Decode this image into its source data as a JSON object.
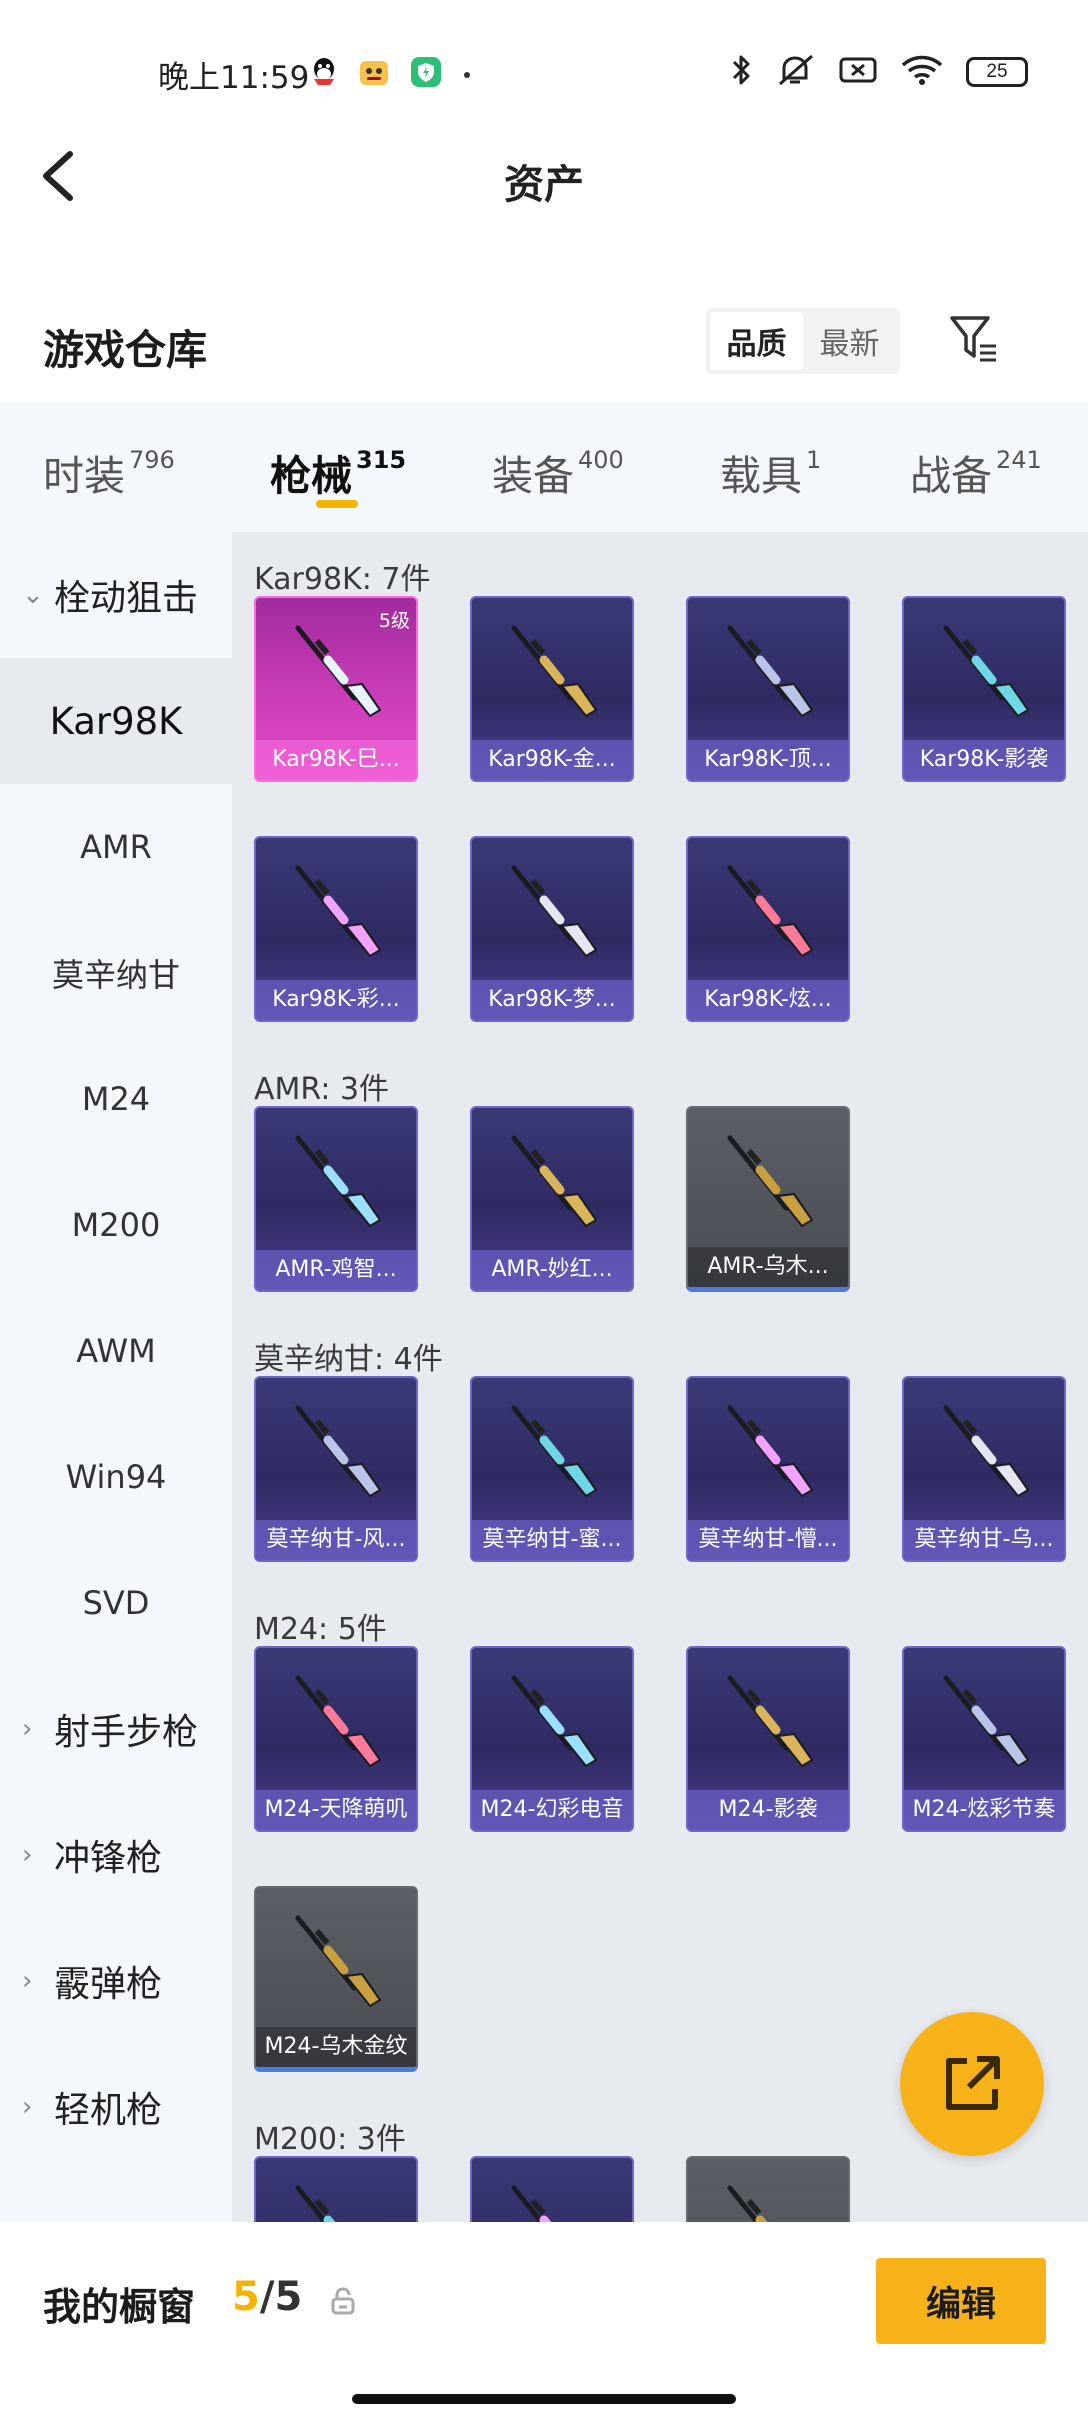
{
  "status_bar": {
    "time": "晚上11:59",
    "battery": "25",
    "left_icons": [
      "qq-icon",
      "bear-app-icon",
      "security-app-icon",
      "dot-icon"
    ],
    "right_icons": [
      "bluetooth-icon",
      "mute-icon",
      "sim-off-icon",
      "wifi-icon",
      "battery-icon"
    ]
  },
  "header": {
    "title": "资产"
  },
  "warehouse": {
    "title": "游戏仓库",
    "sort_options": [
      "品质",
      "最新"
    ],
    "active_sort": "品质"
  },
  "tabs": [
    {
      "label": "时装",
      "count": "796"
    },
    {
      "label": "枪械",
      "count": "315",
      "active": true
    },
    {
      "label": "装备",
      "count": "400"
    },
    {
      "label": "载具",
      "count": "1"
    },
    {
      "label": "战备",
      "count": "241"
    }
  ],
  "sidebar": {
    "items": [
      {
        "label": "栓动狙击",
        "type": "category",
        "expanded": true
      },
      {
        "label": "Kar98K",
        "type": "item",
        "active": true
      },
      {
        "label": "AMR",
        "type": "item"
      },
      {
        "label": "莫辛纳甘",
        "type": "item"
      },
      {
        "label": "M24",
        "type": "item"
      },
      {
        "label": "M200",
        "type": "item"
      },
      {
        "label": "AWM",
        "type": "item"
      },
      {
        "label": "Win94",
        "type": "item"
      },
      {
        "label": "SVD",
        "type": "item"
      },
      {
        "label": "射手步枪",
        "type": "category"
      },
      {
        "label": "冲锋枪",
        "type": "category"
      },
      {
        "label": "霰弹枪",
        "type": "category"
      },
      {
        "label": "轻机枪",
        "type": "category"
      }
    ]
  },
  "sections": [
    {
      "title": "Kar98K: 7件",
      "items": [
        {
          "name": "Kar98K-巳...",
          "style": "pink",
          "level": "5级"
        },
        {
          "name": "Kar98K-金...",
          "style": "purple"
        },
        {
          "name": "Kar98K-顶...",
          "style": "purple"
        },
        {
          "name": "Kar98K-影袭",
          "style": "purple"
        },
        {
          "name": "Kar98K-彩...",
          "style": "purple"
        },
        {
          "name": "Kar98K-梦...",
          "style": "purple"
        },
        {
          "name": "Kar98K-炫...",
          "style": "purple"
        }
      ]
    },
    {
      "title": "AMR: 3件",
      "items": [
        {
          "name": "AMR-鸡智...",
          "style": "purple"
        },
        {
          "name": "AMR-妙红...",
          "style": "purple"
        },
        {
          "name": "AMR-乌木...",
          "style": "gray"
        }
      ]
    },
    {
      "title": "莫辛纳甘: 4件",
      "items": [
        {
          "name": "莫辛纳甘-风...",
          "style": "purple"
        },
        {
          "name": "莫辛纳甘-蜜...",
          "style": "purple"
        },
        {
          "name": "莫辛纳甘-懵...",
          "style": "purple"
        },
        {
          "name": "莫辛纳甘-乌...",
          "style": "purple"
        }
      ]
    },
    {
      "title": "M24: 5件",
      "items": [
        {
          "name": "M24-天降萌叽",
          "style": "purple"
        },
        {
          "name": "M24-幻彩电音",
          "style": "purple"
        },
        {
          "name": "M24-影袭",
          "style": "purple"
        },
        {
          "name": "M24-炫彩节奏",
          "style": "purple"
        },
        {
          "name": "M24-乌木金纹",
          "style": "gray"
        }
      ]
    },
    {
      "title": "M200: 3件",
      "items": [
        {
          "name": "",
          "style": "purple"
        },
        {
          "name": "",
          "style": "purple"
        },
        {
          "name": "",
          "style": "gray"
        }
      ]
    }
  ],
  "fab": {
    "icon": "share-icon"
  },
  "bottom_bar": {
    "label": "我的橱窗",
    "current": "5",
    "total": "/5",
    "edit_label": "编辑"
  },
  "colors": {
    "accent": "#f7b21a",
    "card_purple": "#3a3a78",
    "card_pink": "#cf3fb9",
    "card_gray": "#5b5f66"
  }
}
